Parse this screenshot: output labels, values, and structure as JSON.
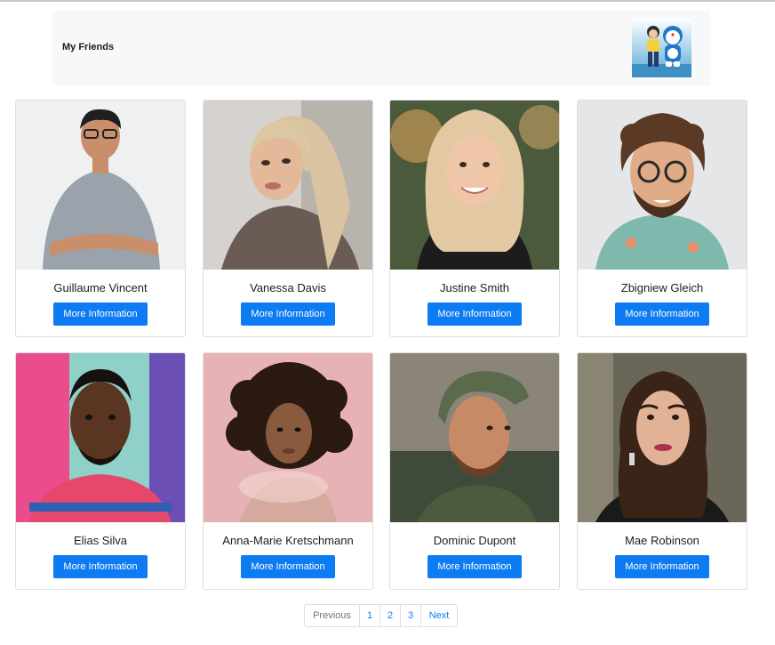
{
  "header": {
    "title": "My Friends",
    "logo_icon": "cartoon-avatar-icon"
  },
  "friends": [
    {
      "name": "Guillaume Vincent",
      "button": "More Information"
    },
    {
      "name": "Vanessa Davis",
      "button": "More Information"
    },
    {
      "name": "Justine Smith",
      "button": "More Information"
    },
    {
      "name": "Zbigniew Gleich",
      "button": "More Information"
    },
    {
      "name": "Elias Silva",
      "button": "More Information"
    },
    {
      "name": "Anna-Marie Kretschmann",
      "button": "More Information"
    },
    {
      "name": "Dominic Dupont",
      "button": "More Information"
    },
    {
      "name": "Mae Robinson",
      "button": "More Information"
    }
  ],
  "pagination": {
    "previous": "Previous",
    "pages": [
      "1",
      "2",
      "3"
    ],
    "next": "Next"
  },
  "colors": {
    "primary": "#0d7bf2",
    "header_bg": "#f7f8fa",
    "border": "#dfdfdf"
  }
}
